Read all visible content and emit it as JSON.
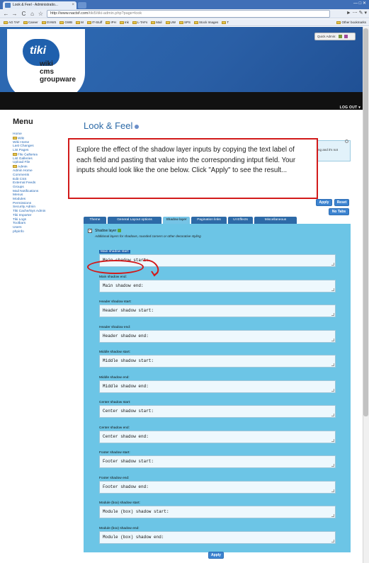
{
  "browser": {
    "tab_title": "Look & Feel - Administratio...",
    "tab_close": "×",
    "url_host": "http://www.nactsf.com",
    "url_path": "/tiki5/tiki-admin.php?page=look",
    "nav_back": "←",
    "nav_forward": "→",
    "nav_reload": "C",
    "nav_home": "⌂",
    "nav_star": "☆",
    "nav_right": "► ⋯ ✎ ▾",
    "window_buttons": "— □ ✕"
  },
  "bookmarks": {
    "items": [
      "AG TAF",
      "Career",
      "GVWS",
      "GWB",
      "M",
      "IT-Stuff",
      "IPH",
      "Ink",
      "L-TAFs",
      "Mail",
      "UW",
      "SPS",
      "Stock Images",
      "T"
    ],
    "other": "Other bookmarks"
  },
  "site": {
    "logo_mark": "tiki",
    "logo_line1": "wiki",
    "logo_line2": "cms",
    "logo_line3": "groupware",
    "quick_admin": "Quick Admin:",
    "logout_label": "LOG OUT ▾"
  },
  "sidebar": {
    "title": "Menu",
    "items": [
      {
        "label": "Home",
        "folder": false
      },
      {
        "label": "Wiki",
        "folder": true
      },
      {
        "label": "Wiki Home",
        "folder": false
      },
      {
        "label": "Last Changes",
        "folder": false
      },
      {
        "label": "List Pages",
        "folder": false
      },
      {
        "label": "File Galleries",
        "folder": true
      },
      {
        "label": "List Galleries",
        "folder": false
      },
      {
        "label": "Upload File",
        "folder": false
      },
      {
        "label": "Admin",
        "folder": true
      },
      {
        "label": "Admin Home",
        "folder": false
      },
      {
        "label": "Comments",
        "folder": false
      },
      {
        "label": "Edit CSS",
        "folder": false
      },
      {
        "label": "External Feeds",
        "folder": false
      },
      {
        "label": "Groups",
        "folder": false
      },
      {
        "label": "Mail Notifications",
        "folder": false
      },
      {
        "label": "Menus",
        "folder": false
      },
      {
        "label": "Modules",
        "folder": false
      },
      {
        "label": "Permissions",
        "folder": false
      },
      {
        "label": "Security Admin",
        "folder": false
      },
      {
        "label": "Tiki Cache/Sys Admin",
        "folder": false
      },
      {
        "label": "Tiki Importer",
        "folder": false
      },
      {
        "label": "Tiki Logs",
        "folder": false
      },
      {
        "label": "Toolbars",
        "folder": false
      },
      {
        "label": "Users",
        "folder": false
      },
      {
        "label": "phpinfo",
        "folder": false
      }
    ]
  },
  "main": {
    "page_title": "Look & Feel",
    "info_text": "ng and it's not",
    "callout_text": "Explore the effect of the shadow layer inputs by copying the text label of each field and pasting that value into the corresponding intput field.  Your inputs should look like the one below.  Click \"Apply\" to see the result...",
    "apply_label": "Apply",
    "reset_label": "Reset",
    "no_tabs_label": "No Tabs",
    "tabs": [
      "Theme",
      "General Layout options",
      "Shadow layer",
      "Pagination links",
      "UI Effects",
      "Miscellaneous"
    ],
    "active_tab": "Shadow layer",
    "checkbox_mark": "✓",
    "checkbox_label": "Shadow layer",
    "checkbox_desc": "Additional layers for shadows, rounded corners or other decorative styling",
    "fields": [
      {
        "label": "Main shadow start:",
        "value": "Main shadow start:"
      },
      {
        "label": "Main shadow end:",
        "value": "Main shadow end:"
      },
      {
        "label": "Header shadow start:",
        "value": "Header shadow start:"
      },
      {
        "label": "Header shadow end:",
        "value": "Header shadow end:"
      },
      {
        "label": "Middle shadow start:",
        "value": "Middle shadow start:"
      },
      {
        "label": "Middle shadow end:",
        "value": "Middle shadow end:"
      },
      {
        "label": "Center shadow start:",
        "value": "Center shadow start:"
      },
      {
        "label": "Center shadow end:",
        "value": "Center shadow end:"
      },
      {
        "label": "Footer shadow start:",
        "value": "Footer shadow start:"
      },
      {
        "label": "Footer shadow end:",
        "value": "Footer shadow end:"
      },
      {
        "label": "Module (box) shadow start:",
        "value": "Module (box) shadow start:"
      },
      {
        "label": "Module (box) shadow end:",
        "value": "Module (box) shadow end:"
      }
    ],
    "apply_bottom_label": "Apply"
  },
  "colors": {
    "header_blue": "#2d6bb5",
    "panel_blue": "#6cc5e6",
    "callout_red": "#d21a1a",
    "link_blue": "#2467b5"
  }
}
